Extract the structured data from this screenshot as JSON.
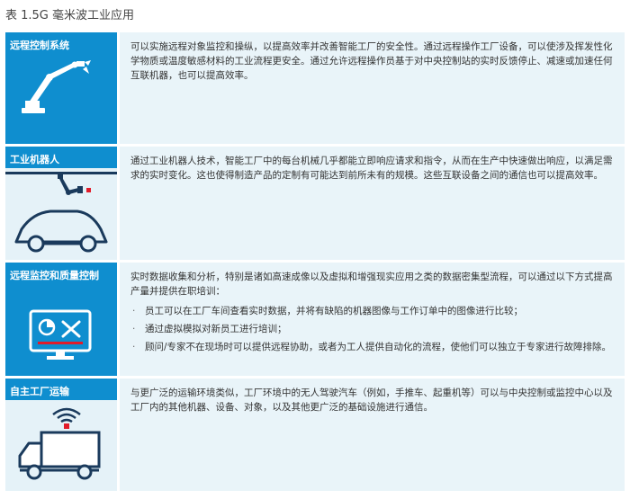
{
  "caption": "表 1.5G 毫米波工业应用",
  "rows": [
    {
      "label": "远程控制系统",
      "icon": "robotic-arm-icon",
      "text": "可以实施远程对象监控和操纵，以提高效率并改善智能工厂的安全性。通过远程操作工厂设备，可以使涉及挥发性化学物质或温度敏感材料的工业流程更安全。通过允许远程操作员基于对中央控制站的实时反馈停止、减速或加速任何互联机器，也可以提高效率。"
    },
    {
      "label": "工业机器人",
      "icon": "car-assembly-robot-icon",
      "text": "通过工业机器人技术，智能工厂中的每台机械几乎都能立即响应请求和指令，从而在生产中快速做出响应，以满足需求的实时变化。这也使得制造产品的定制有可能达到前所未有的规模。这些互联设备之间的通信也可以提高效率。"
    },
    {
      "label": "远程监控和质量控制",
      "icon": "monitor-dashboard-icon",
      "text": "实时数据收集和分析，特别是诸如高速成像以及虚拟和增强现实应用之类的数据密集型流程，可以通过以下方式提高产量并提供在职培训：",
      "bullets": [
        "员工可以在工厂车间查看实时数据，并将有缺陷的机器图像与工作订单中的图像进行比较；",
        "通过虚拟模拟对新员工进行培训；",
        "顾问/专家不在现场时可以提供远程协助，或者为工人提供自动化的流程，使他们可以独立于专家进行故障排除。"
      ]
    },
    {
      "label": "自主工厂运输",
      "icon": "autonomous-truck-icon",
      "text": "与更广泛的运输环境类似，工厂环境中的无人驾驶汽车（例如，手推车、起重机等）可以与中央控制或监控中心以及工厂内的其他机器、设备、对象，以及其他更广泛的基础设施进行通信。"
    }
  ],
  "colors": {
    "accent": "#0f8ecf",
    "panel": "#e9f4f9",
    "light": "#e5f2f8"
  }
}
